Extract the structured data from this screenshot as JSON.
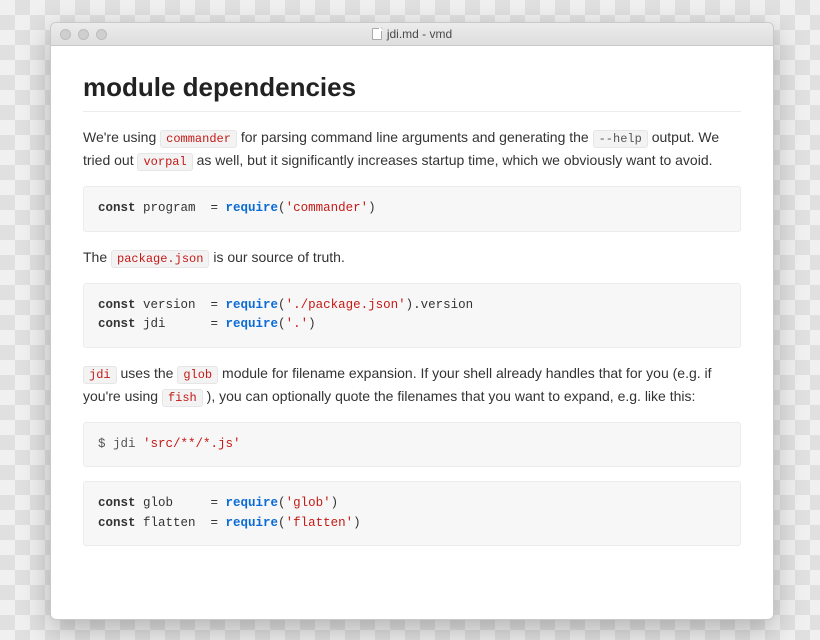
{
  "titlebar": {
    "title": "jdi.md - vmd"
  },
  "doc": {
    "heading": "module dependencies",
    "p1": {
      "t1": "We're using ",
      "c1": "commander",
      "t2": " for parsing command line arguments and generating the ",
      "c2": "--help",
      "t3": " output. We tried out ",
      "c3": "vorpal",
      "t4": " as well, but it significantly increases startup time, which we obviously want to avoid."
    },
    "code1": {
      "kw1": "const",
      "v1": " program  = ",
      "fn": "require",
      "p1": "(",
      "s1": "'commander'",
      "p2": ")"
    },
    "p2": {
      "t1": "The ",
      "c1": "package.json",
      "t2": " is our source of truth."
    },
    "code2": {
      "l1": {
        "kw": "const",
        "v": " version  = ",
        "fn": "require",
        "p1": "(",
        "s": "'./package.json'",
        "p2": ").version"
      },
      "l2": {
        "kw": "const",
        "v": " jdi      = ",
        "fn": "require",
        "p1": "(",
        "s": "'.'",
        "p2": ")"
      }
    },
    "p3": {
      "c1": "jdi",
      "t1": " uses the ",
      "c2": "glob",
      "t2": " module for filename expansion. If your shell already handles that for you (e.g. if you're using ",
      "c3": "fish",
      "t3": " ), you can optionally quote the filenames that you want to expand, e.g. like this:"
    },
    "code3": {
      "prompt": "$ jdi ",
      "s": "'src/**/*.js'"
    },
    "code4": {
      "l1": {
        "kw": "const",
        "v": " glob     = ",
        "fn": "require",
        "p1": "(",
        "s": "'glob'",
        "p2": ")"
      },
      "l2": {
        "kw": "const",
        "v": " flatten  = ",
        "fn": "require",
        "p1": "(",
        "s": "'flatten'",
        "p2": ")"
      }
    }
  }
}
